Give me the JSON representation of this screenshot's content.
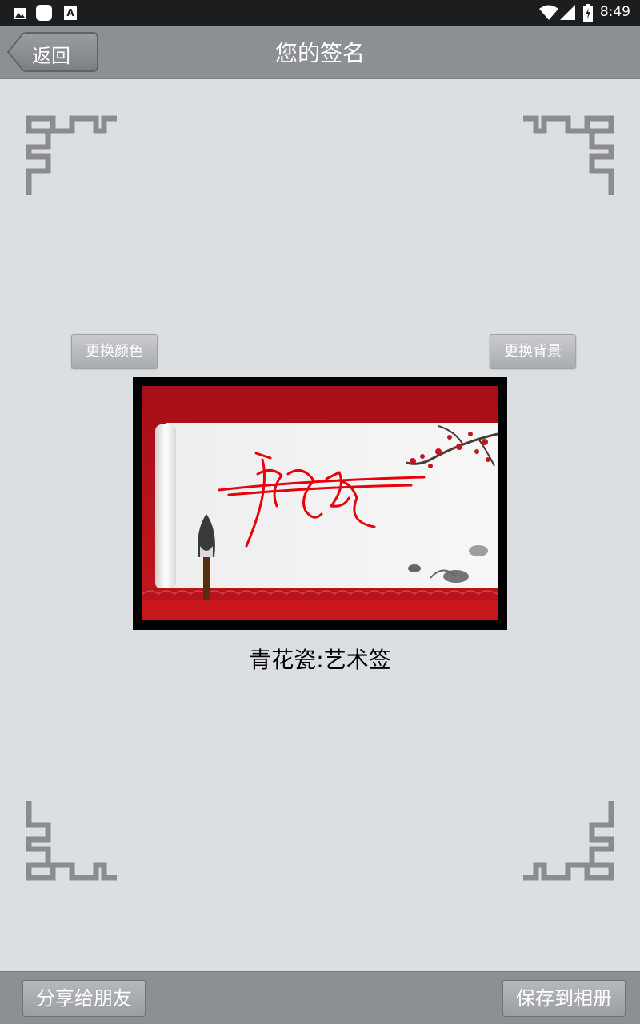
{
  "status_bar": {
    "time": "8:49",
    "icons": [
      "image-icon",
      "app-icon",
      "font-icon",
      "wifi-icon",
      "signal-icon",
      "battery-charging-icon"
    ]
  },
  "header": {
    "back_label": "返回",
    "title": "您的签名"
  },
  "controls": {
    "change_color_label": "更换颜色",
    "change_background_label": "更换背景"
  },
  "signature": {
    "caption": "青花瓷:艺术签",
    "stroke_color": "#e8000c",
    "frame_color": "#000000",
    "scene_red": "#b5121b"
  },
  "bottom_bar": {
    "share_label": "分享给朋友",
    "save_label": "保存到相册"
  },
  "colors": {
    "background": "#dcdfe2",
    "bar": "#8c8f93",
    "ornament": "#8a8c8f"
  }
}
